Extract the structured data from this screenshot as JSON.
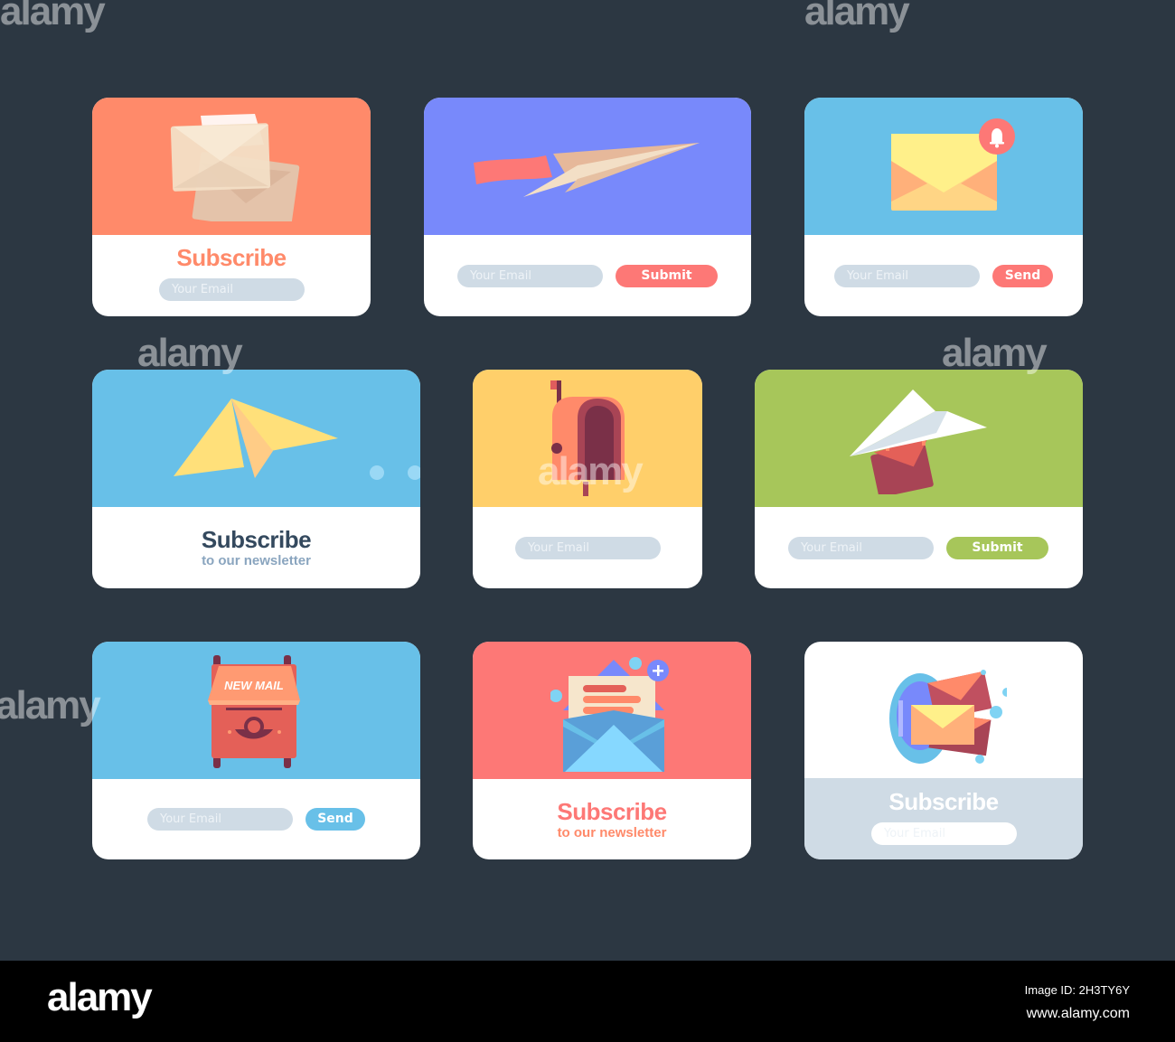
{
  "colors": {
    "background": "#2c3742",
    "coral": "#ff8a6a",
    "periwinkle": "#7889fb",
    "sky": "#68c0e8",
    "yellow": "#ffcf6a",
    "green": "#a7c65a",
    "salmon": "#fd7876",
    "input": "#cfdbe5",
    "dark_text": "#34495e",
    "muted_text": "#8aa5bf"
  },
  "cards": [
    {
      "id": "card-1",
      "illustration": "envelopes-icon",
      "title": "Subscribe",
      "email_placeholder": "Your Email"
    },
    {
      "id": "card-2",
      "illustration": "paper-plane-banner-icon",
      "email_placeholder": "Your Email",
      "button": "Submit"
    },
    {
      "id": "card-3",
      "illustration": "envelope-bell-icon",
      "email_placeholder": "Your Email",
      "button": "Send"
    },
    {
      "id": "card-4",
      "illustration": "paper-plane-icon",
      "title": "Subscribe",
      "subtitle": "to our newsletter"
    },
    {
      "id": "card-5",
      "illustration": "mailbox-icon",
      "email_placeholder": "Your Email"
    },
    {
      "id": "card-6",
      "illustration": "paper-plane-envelope-icon",
      "email_placeholder": "Your Email",
      "button": "Submit"
    },
    {
      "id": "card-7",
      "illustration": "new-mail-box-icon",
      "illustration_text": "NEW MAIL",
      "email_placeholder": "Your Email",
      "button": "Send"
    },
    {
      "id": "card-8",
      "illustration": "open-envelope-letter-icon",
      "title": "Subscribe",
      "subtitle": "to our newsletter"
    },
    {
      "id": "card-9",
      "illustration": "portal-envelopes-icon",
      "title": "Subscribe",
      "email_placeholder": "Your Email"
    }
  ],
  "watermark": {
    "text": "alamy",
    "letter": "a"
  },
  "footer": {
    "logo": "alamy",
    "image_id": "Image ID: 2H3TY6Y",
    "site": "www.alamy.com"
  }
}
